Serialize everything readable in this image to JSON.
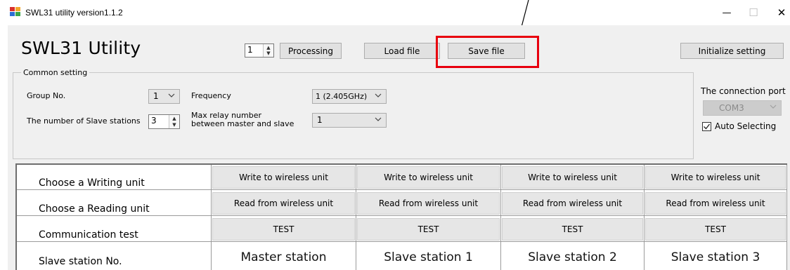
{
  "window": {
    "title": "SWL31 utility version1.1.2",
    "minimize_glyph": "—",
    "maximize_glyph": "☐",
    "close_glyph": "✕"
  },
  "app": {
    "heading": "SWL31 Utility"
  },
  "toolbar": {
    "processing_count": "1",
    "processing_label": "Processing",
    "load_label": "Load file",
    "save_label": "Save file",
    "initialize_label": "Initialize setting"
  },
  "highlight_color": "#e8000e",
  "common": {
    "group_title": "Common setting",
    "group_no_label": "Group No.",
    "group_no_value": "1",
    "slave_count_label": "The number of Slave stations",
    "slave_count_value": "3",
    "frequency_label": "Frequency",
    "frequency_value": "1  (2.405GHz)",
    "relay_label_line1": "Max relay number",
    "relay_label_line2": "between master and slave",
    "relay_value": "1"
  },
  "connection": {
    "label": "The connection port",
    "port_value": "COM3",
    "auto_label": "Auto Selecting",
    "auto_checked": true
  },
  "grid": {
    "rows": [
      {
        "label": "Choose a Writing unit"
      },
      {
        "label": "Choose a Reading unit"
      },
      {
        "label": "Communication test"
      },
      {
        "label": "Slave station No."
      }
    ],
    "write_buttons": [
      "Write to wireless unit",
      "Write to wireless unit",
      "Write to wireless unit",
      "Write to wireless unit"
    ],
    "read_buttons": [
      "Read from wireless unit",
      "Read from wireless unit",
      "Read from wireless unit",
      "Read from wireless unit"
    ],
    "test_buttons": [
      "TEST",
      "TEST",
      "TEST",
      "TEST"
    ],
    "stations": [
      "Master station",
      "Slave station 1",
      "Slave station 2",
      "Slave station 3"
    ]
  }
}
